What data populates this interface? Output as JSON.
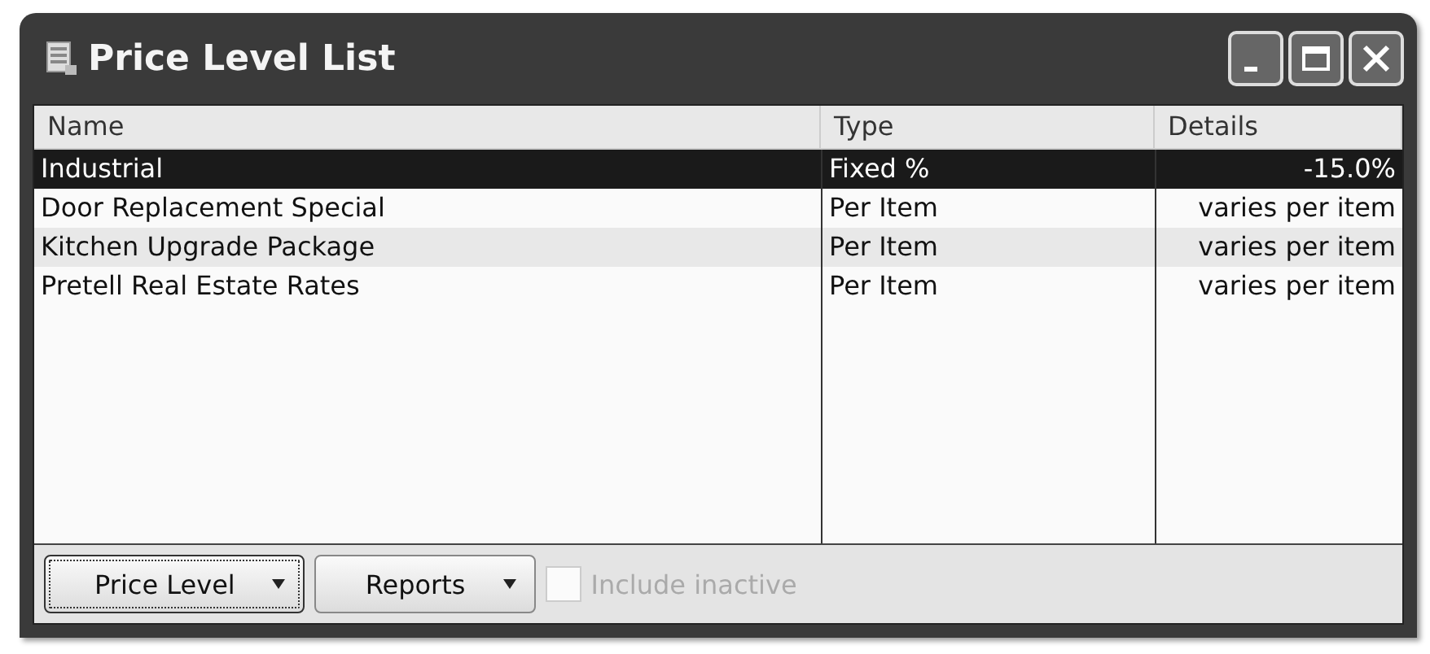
{
  "window": {
    "title": "Price Level List"
  },
  "table": {
    "columns": [
      "Name",
      "Type",
      "Details"
    ],
    "rows": [
      {
        "cells": [
          "Industrial",
          "Fixed %",
          "-15.0%"
        ],
        "selected": true
      },
      {
        "cells": [
          "Door Replacement Special",
          "Per Item",
          "varies per item"
        ],
        "selected": false
      },
      {
        "cells": [
          "Kitchen Upgrade Package",
          "Per Item",
          "varies per item"
        ],
        "selected": false
      },
      {
        "cells": [
          "Pretell Real Estate Rates",
          "Per Item",
          "varies per item"
        ],
        "selected": false
      }
    ]
  },
  "buttons": [
    {
      "label": "Price Level",
      "focused": true
    },
    {
      "label": "Reports",
      "focused": false
    }
  ],
  "include_inactive": {
    "label": "Include inactive",
    "checked": false,
    "disabled": true
  }
}
